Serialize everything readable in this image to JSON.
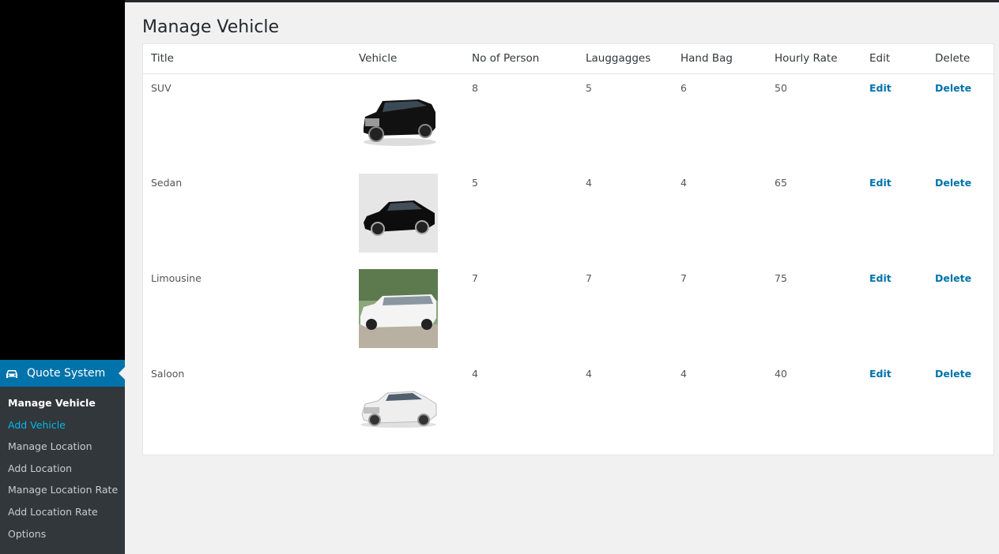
{
  "page": {
    "title": "Manage Vehicle"
  },
  "menu": {
    "parent_label": "Quote System",
    "items": [
      {
        "label": "Manage Vehicle",
        "state": "current"
      },
      {
        "label": "Add Vehicle",
        "state": "hover"
      },
      {
        "label": "Manage Location",
        "state": "normal"
      },
      {
        "label": "Add Location",
        "state": "normal"
      },
      {
        "label": "Manage Location Rate",
        "state": "normal"
      },
      {
        "label": "Add Location Rate",
        "state": "normal"
      },
      {
        "label": "Options",
        "state": "normal"
      }
    ]
  },
  "table": {
    "headers": [
      "Title",
      "Vehicle",
      "No of Person",
      "Lauggagges",
      "Hand Bag",
      "Hourly Rate",
      "Edit",
      "Delete"
    ],
    "rows": [
      {
        "title": "SUV",
        "persons": "8",
        "luggages": "5",
        "hand_bag": "6",
        "hourly_rate": "50",
        "edit": "Edit",
        "delete": "Delete"
      },
      {
        "title": "Sedan",
        "persons": "5",
        "luggages": "4",
        "hand_bag": "4",
        "hourly_rate": "65",
        "edit": "Edit",
        "delete": "Delete"
      },
      {
        "title": "Limousine",
        "persons": "7",
        "luggages": "7",
        "hand_bag": "7",
        "hourly_rate": "75",
        "edit": "Edit",
        "delete": "Delete"
      },
      {
        "title": "Saloon",
        "persons": "4",
        "luggages": "4",
        "hand_bag": "4",
        "hourly_rate": "40",
        "edit": "Edit",
        "delete": "Delete"
      }
    ]
  },
  "colors": {
    "accent": "#0073aa",
    "menu_bg": "#000000",
    "submenu_bg": "#32373c",
    "link_hover": "#00b9eb"
  },
  "icons": {
    "menu_parent": "car-icon"
  }
}
